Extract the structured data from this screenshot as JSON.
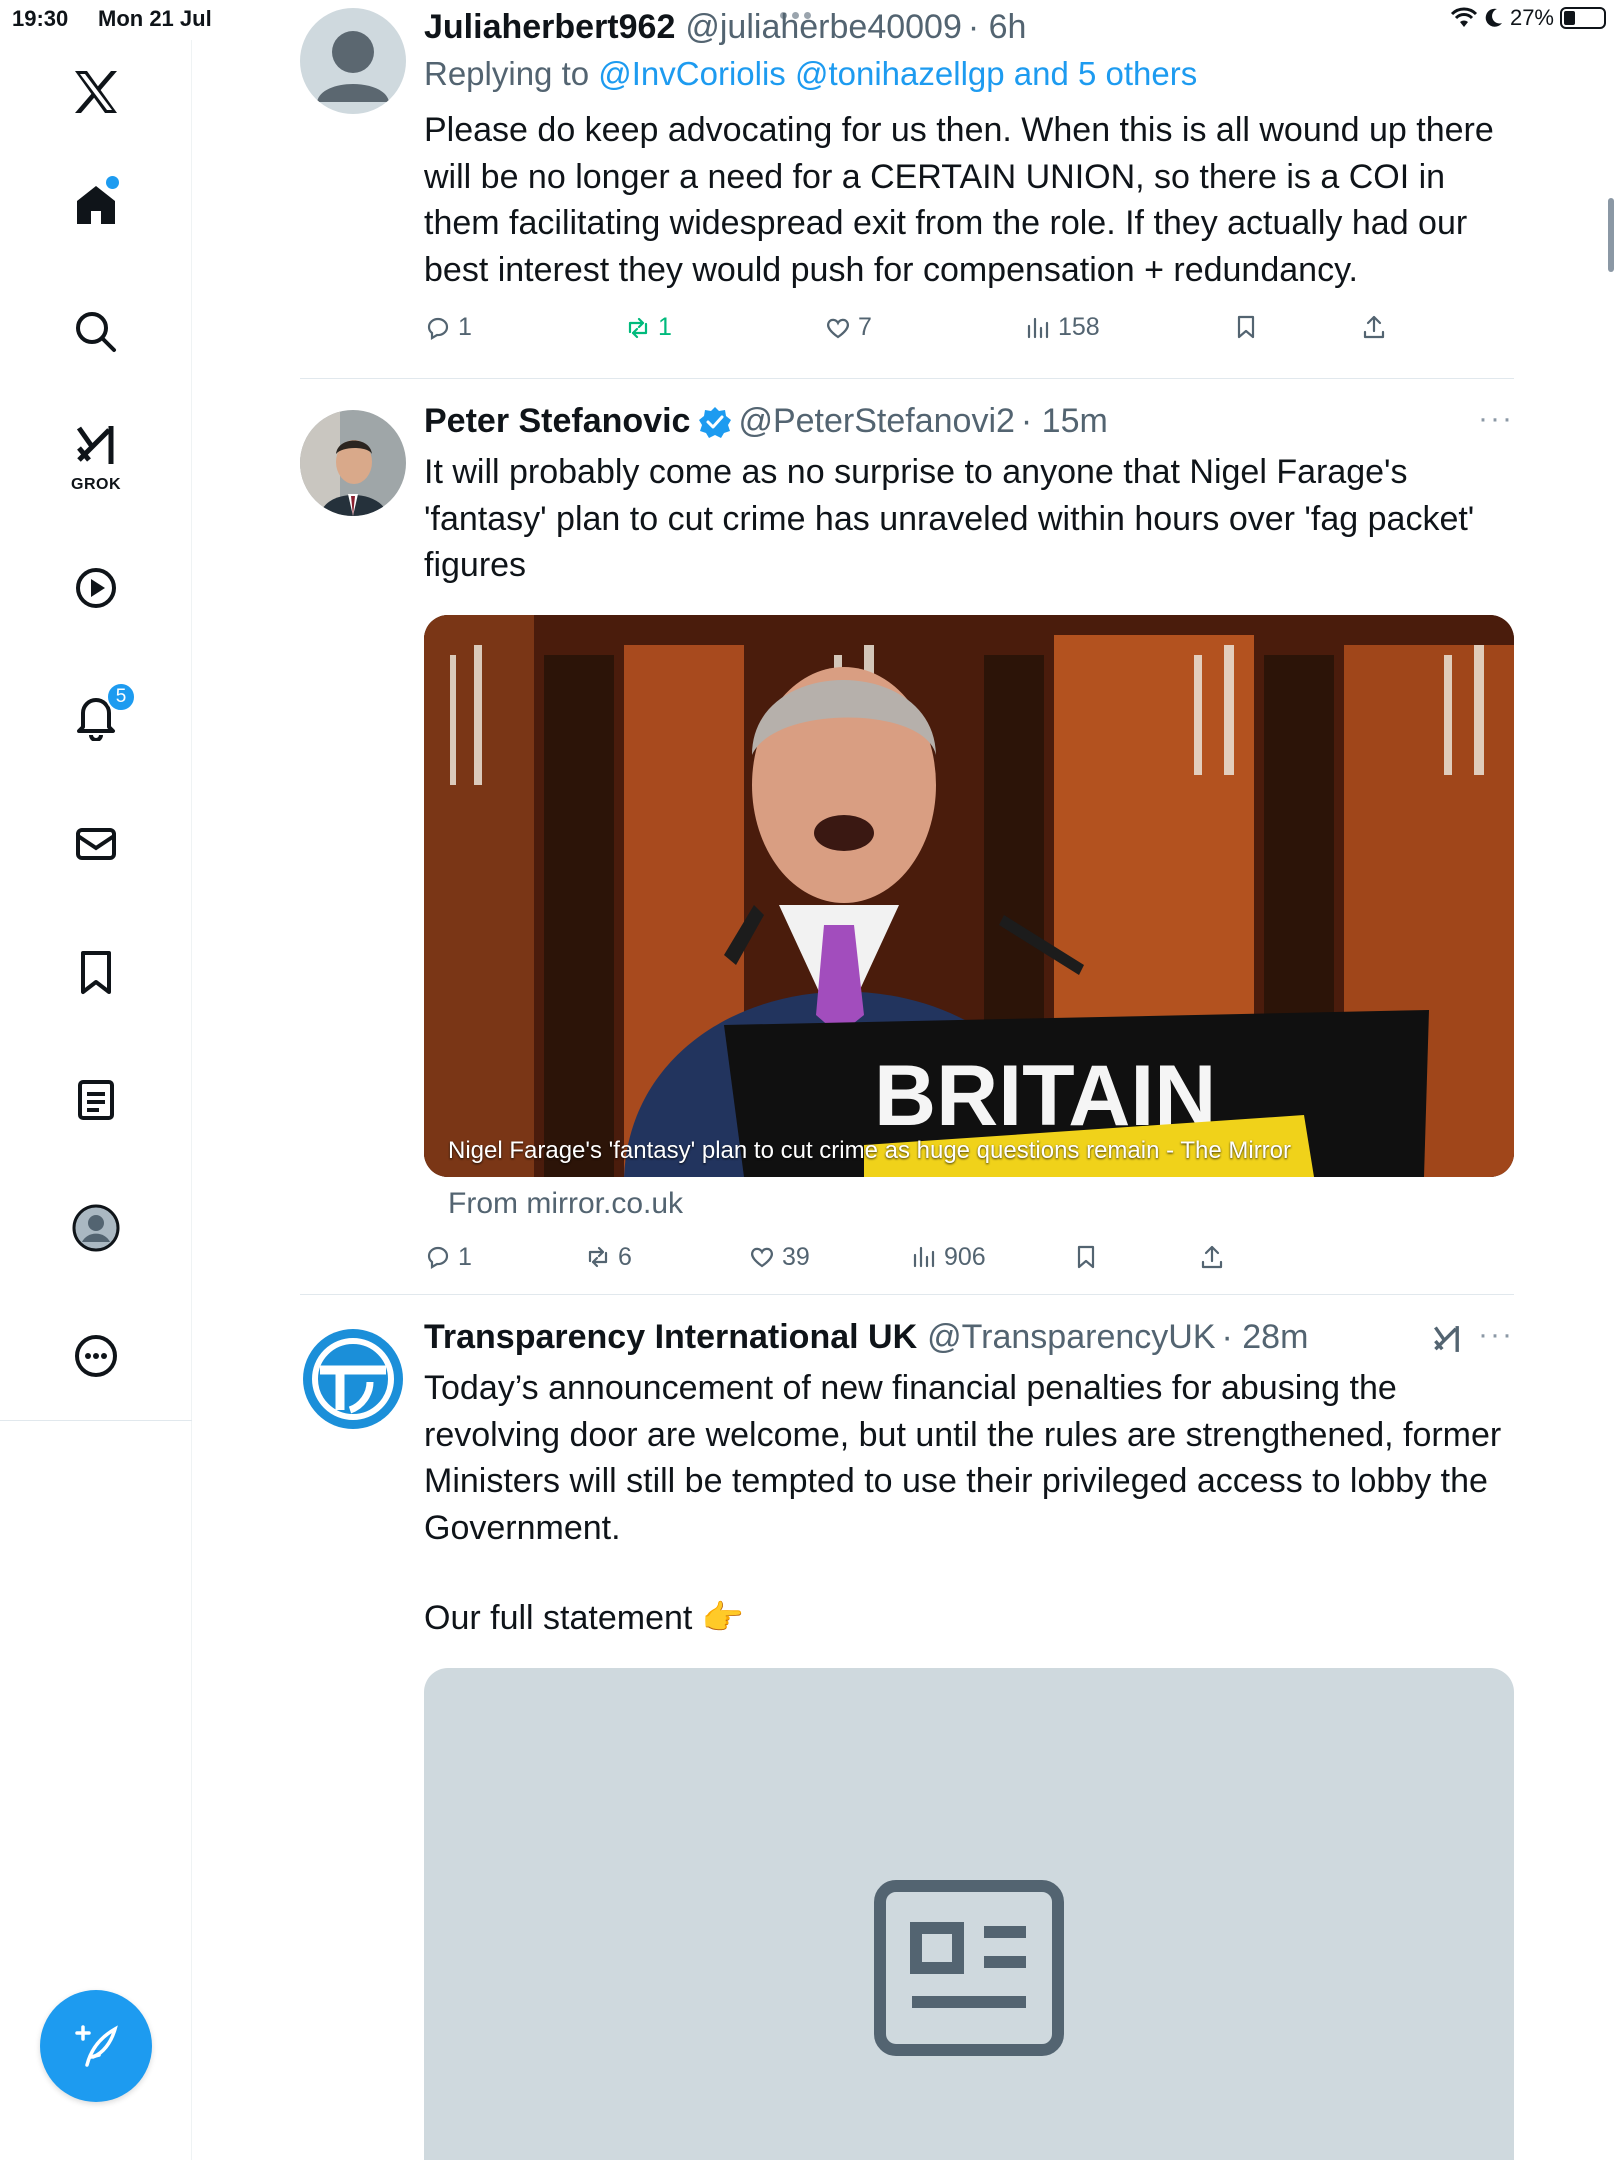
{
  "status_bar": {
    "time": "19:30",
    "date": "Mon 21 Jul",
    "battery": "27%",
    "battery_level": 0.27
  },
  "sidebar": {
    "items": [
      {
        "name": "x-logo",
        "label": "X"
      },
      {
        "name": "home",
        "label": "Home",
        "has_dot": true
      },
      {
        "name": "search",
        "label": "Search"
      },
      {
        "name": "grok",
        "label": "GROK"
      },
      {
        "name": "video",
        "label": "Video"
      },
      {
        "name": "notifications",
        "label": "Notifications",
        "badge": "5"
      },
      {
        "name": "messages",
        "label": "Messages"
      },
      {
        "name": "bookmarks",
        "label": "Bookmarks"
      },
      {
        "name": "articles",
        "label": "Articles"
      },
      {
        "name": "profile",
        "label": "Profile"
      },
      {
        "name": "more",
        "label": "More"
      }
    ],
    "compose_icon": "compose-icon"
  },
  "tweets": [
    {
      "name": "Juliaherbert962",
      "handle": "@juliaherbe40009",
      "time": "· 6h",
      "replying_prefix": "Replying to ",
      "replying_to": "@InvCoriolis @tonihazellgp and 5 others",
      "text": "Please do keep advocating for us then. When this is all wound up there will be no longer a need for a CERTAIN UNION, so there is a COI in them facilitating widespread exit from the role. If they actually had our best interest they would push for compensation + redundancy.",
      "replies": "1",
      "reposts": "1",
      "likes": "7",
      "views": "158"
    },
    {
      "name": "Peter Stefanovic",
      "handle": "@PeterStefanovi2",
      "time": "· 15m",
      "verified": true,
      "text": "It will probably come as no surprise to anyone that Nigel Farage's 'fantasy' plan to cut crime has unraveled within hours over 'fag packet' figures",
      "card_caption": "Nigel Farage's 'fantasy' plan to cut crime as huge questions remain - The Mirror",
      "card_sign_text": "BRITAIN",
      "card_source": "From mirror.co.uk",
      "replies": "1",
      "reposts": "6",
      "likes": "39",
      "views": "906"
    },
    {
      "name": "Transparency International UK",
      "handle": "@TransparencyUK",
      "time": "· 28m",
      "text": "Today’s announcement of new financial penalties for abusing the revolving door are welcome, but until the rules are strengthened, former Ministers will still be tempted to use their privileged access to lobby the Government.",
      "text2": "Our full statement 👉"
    }
  ],
  "colors": {
    "accent": "#1d9bf0",
    "repost_active": "#00ba7c",
    "secondary_text": "#536471"
  }
}
